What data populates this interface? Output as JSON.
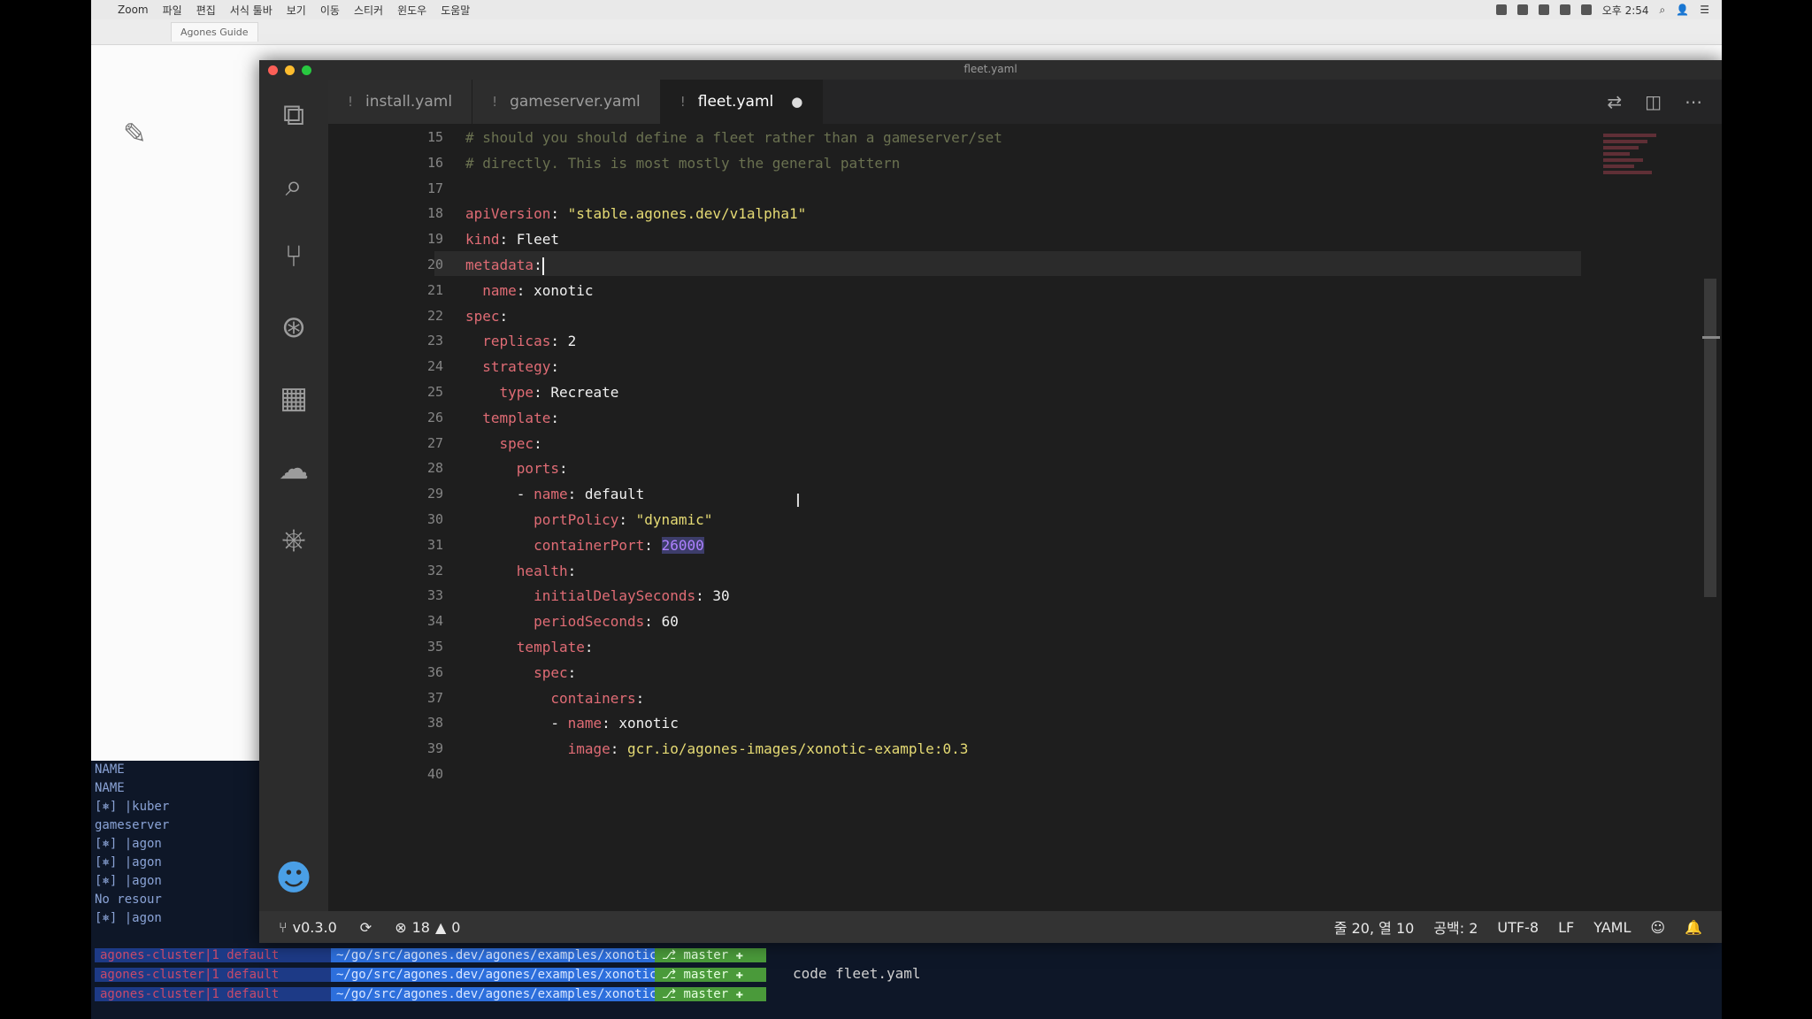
{
  "menubar": {
    "app_name": "Zoom",
    "items": [
      "파일",
      "편집",
      "서식 툴바",
      "보기",
      "이동",
      "스티커",
      "윈도우",
      "도움말"
    ],
    "clock": "오후 2:54"
  },
  "browser": {
    "tab_title": "Agones Guide"
  },
  "window": {
    "title": "fleet.yaml"
  },
  "tabs": [
    {
      "label": "install.yaml",
      "active": false
    },
    {
      "label": "gameserver.yaml",
      "active": false
    },
    {
      "label": "fleet.yaml",
      "active": true,
      "modified_mark": "●"
    }
  ],
  "editor": {
    "lines": [
      {
        "n": "15",
        "tokens": [
          [
            "cmt",
            "# should you should define a fleet rather than a gameserver/set"
          ]
        ]
      },
      {
        "n": "16",
        "tokens": [
          [
            "cmt",
            "# directly. This is most mostly the general pattern"
          ]
        ]
      },
      {
        "n": "17",
        "tokens": []
      },
      {
        "n": "18",
        "tokens": [
          [
            "key",
            "apiVersion"
          ],
          [
            "plain",
            ": "
          ],
          [
            "str",
            "\"stable.agones.dev/v1alpha1\""
          ]
        ]
      },
      {
        "n": "19",
        "tokens": [
          [
            "key",
            "kind"
          ],
          [
            "plain",
            ": Fleet"
          ]
        ]
      },
      {
        "n": "20",
        "tokens": [
          [
            "key",
            "metadata"
          ],
          [
            "plain",
            ":"
          ]
        ],
        "cursor": true
      },
      {
        "n": "21",
        "tokens": [
          [
            "plain",
            "  "
          ],
          [
            "key",
            "name"
          ],
          [
            "plain",
            ": xonotic"
          ]
        ]
      },
      {
        "n": "22",
        "tokens": [
          [
            "key",
            "spec"
          ],
          [
            "plain",
            ":"
          ]
        ]
      },
      {
        "n": "23",
        "tokens": [
          [
            "plain",
            "  "
          ],
          [
            "key",
            "replicas"
          ],
          [
            "plain",
            ": 2"
          ]
        ]
      },
      {
        "n": "24",
        "tokens": [
          [
            "plain",
            "  "
          ],
          [
            "key",
            "strategy"
          ],
          [
            "plain",
            ":"
          ]
        ]
      },
      {
        "n": "25",
        "tokens": [
          [
            "plain",
            "    "
          ],
          [
            "key",
            "type"
          ],
          [
            "plain",
            ": Recreate"
          ]
        ]
      },
      {
        "n": "26",
        "tokens": [
          [
            "plain",
            "  "
          ],
          [
            "key",
            "template"
          ],
          [
            "plain",
            ":"
          ]
        ]
      },
      {
        "n": "27",
        "tokens": [
          [
            "plain",
            "    "
          ],
          [
            "key",
            "spec"
          ],
          [
            "plain",
            ":"
          ]
        ]
      },
      {
        "n": "28",
        "tokens": [
          [
            "plain",
            "      "
          ],
          [
            "key",
            "ports"
          ],
          [
            "plain",
            ":"
          ]
        ]
      },
      {
        "n": "29",
        "tokens": [
          [
            "plain",
            "      - "
          ],
          [
            "key",
            "name"
          ],
          [
            "plain",
            ": default"
          ]
        ]
      },
      {
        "n": "30",
        "tokens": [
          [
            "plain",
            "        "
          ],
          [
            "key",
            "portPolicy"
          ],
          [
            "plain",
            ": "
          ],
          [
            "str",
            "\"dynamic\""
          ]
        ]
      },
      {
        "n": "31",
        "tokens": [
          [
            "plain",
            "        "
          ],
          [
            "key",
            "containerPort"
          ],
          [
            "plain",
            ": "
          ],
          [
            "numsel",
            "26000"
          ]
        ]
      },
      {
        "n": "32",
        "tokens": [
          [
            "plain",
            "      "
          ],
          [
            "key",
            "health"
          ],
          [
            "plain",
            ":"
          ]
        ]
      },
      {
        "n": "33",
        "tokens": [
          [
            "plain",
            "        "
          ],
          [
            "key",
            "initialDelaySeconds"
          ],
          [
            "plain",
            ": 30"
          ]
        ]
      },
      {
        "n": "34",
        "tokens": [
          [
            "plain",
            "        "
          ],
          [
            "key",
            "periodSeconds"
          ],
          [
            "plain",
            ": 60"
          ]
        ]
      },
      {
        "n": "35",
        "tokens": [
          [
            "plain",
            "      "
          ],
          [
            "key",
            "template"
          ],
          [
            "plain",
            ":"
          ]
        ]
      },
      {
        "n": "36",
        "tokens": [
          [
            "plain",
            "        "
          ],
          [
            "key",
            "spec"
          ],
          [
            "plain",
            ":"
          ]
        ]
      },
      {
        "n": "37",
        "tokens": [
          [
            "plain",
            "          "
          ],
          [
            "key",
            "containers"
          ],
          [
            "plain",
            ":"
          ]
        ]
      },
      {
        "n": "38",
        "tokens": [
          [
            "plain",
            "          - "
          ],
          [
            "key",
            "name"
          ],
          [
            "plain",
            ": xonotic"
          ]
        ]
      },
      {
        "n": "39",
        "tokens": [
          [
            "plain",
            "            "
          ],
          [
            "key",
            "image"
          ],
          [
            "plain",
            ": "
          ],
          [
            "str",
            "gcr.io/agones-images/xonotic-example:0.3"
          ]
        ]
      },
      {
        "n": "40",
        "tokens": []
      }
    ]
  },
  "statusbar": {
    "branch": "v0.3.0",
    "sync_icon": "sync-icon",
    "errors": "18",
    "warnings": "0",
    "cursor_pos": "줄 20, 열 10",
    "indent": "공백: 2",
    "encoding": "UTF-8",
    "eol": "LF",
    "language": "YAML"
  },
  "terminal": {
    "left_lines": [
      "NAME",
      "NAME",
      "[⎈] |kuber",
      "gameserver",
      "[⎈] |agon",
      "[⎈] |agon",
      "[⎈] |agon",
      "No resour",
      "[⎈] |agon"
    ],
    "prompts": [
      {
        "ctx": "agones-cluster|1 default",
        "path": "~/go/src/agones.dev/agones/examples/xonotic",
        "git": "⎇ master ✚"
      },
      {
        "ctx": "agones-cluster|1 default",
        "path": "~/go/src/agones.dev/agones/examples/xonotic",
        "git": "⎇ master ✚"
      },
      {
        "ctx": "agones-cluster|1 default",
        "path": "~/go/src/agones.dev/agones/examples/xonotic",
        "git": "⎇ master ✚"
      }
    ],
    "command": "code fleet.yaml"
  },
  "colors": {
    "editor_bg": "#1e1e1e",
    "key": "#e06c75",
    "string": "#e6db74",
    "comment": "#6a7150",
    "number": "#ae81ff"
  }
}
